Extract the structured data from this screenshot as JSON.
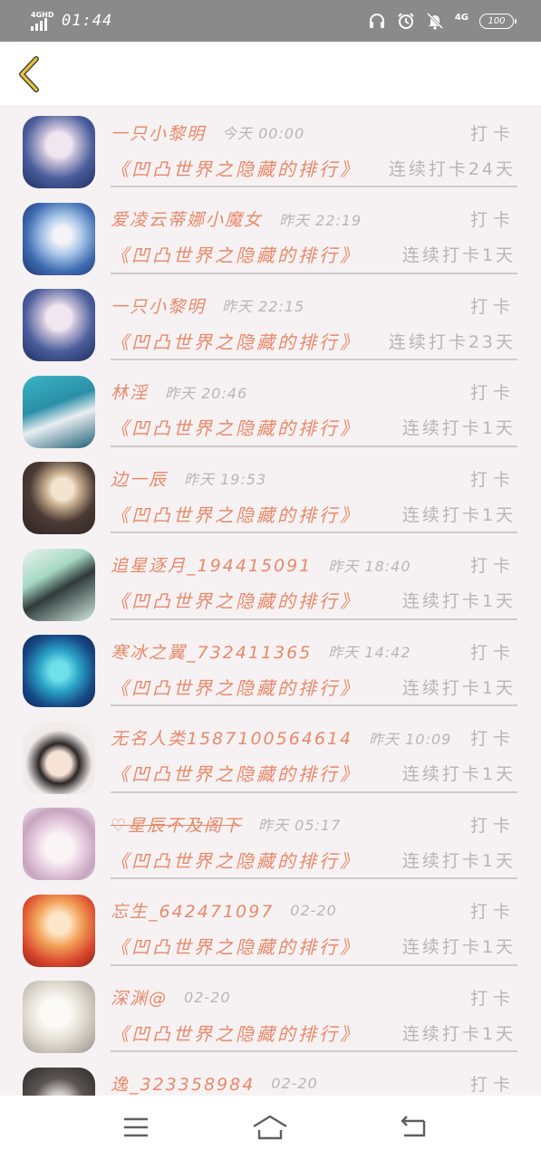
{
  "status_bar": {
    "network": "4GHD",
    "time": "01:44",
    "net_right": "4G",
    "battery": "100"
  },
  "header": {
    "back_icon": "chevron-left-icon",
    "accent_color": "#e8c23a"
  },
  "colors": {
    "name": "#e8896a",
    "muted": "#b9b4b5",
    "background": "#f6f2f3"
  },
  "entries": [
    {
      "name": "一只小黎明",
      "time": "今天 00:00",
      "action": "打卡",
      "board": "《凹凸世界之隐藏的排行》",
      "streak": "连续打卡24天"
    },
    {
      "name": "爱凌云蒂娜小魔女",
      "time": "昨天 22:19",
      "action": "打卡",
      "board": "《凹凸世界之隐藏的排行》",
      "streak": "连续打卡1天"
    },
    {
      "name": "一只小黎明",
      "time": "昨天 22:15",
      "action": "打卡",
      "board": "《凹凸世界之隐藏的排行》",
      "streak": "连续打卡23天"
    },
    {
      "name": "林淫",
      "time": "昨天 20:46",
      "action": "打卡",
      "board": "《凹凸世界之隐藏的排行》",
      "streak": "连续打卡1天"
    },
    {
      "name": "边一辰",
      "time": "昨天 19:53",
      "action": "打卡",
      "board": "《凹凸世界之隐藏的排行》",
      "streak": "连续打卡1天"
    },
    {
      "name": "追星逐月_194415091",
      "time": "昨天 18:40",
      "action": "打卡",
      "board": "《凹凸世界之隐藏的排行》",
      "streak": "连续打卡1天"
    },
    {
      "name": "寒冰之翼_732411365",
      "time": "昨天 14:42",
      "action": "打卡",
      "board": "《凹凸世界之隐藏的排行》",
      "streak": "连续打卡1天"
    },
    {
      "name": "无名人类1587100564614",
      "time": "昨天 10:09",
      "action": "打卡",
      "board": "《凹凸世界之隐藏的排行》",
      "streak": "连续打卡1天"
    },
    {
      "name": "♡星辰不及阁下",
      "time": "昨天 05:17",
      "action": "打卡",
      "board": "《凹凸世界之隐藏的排行》",
      "streak": "连续打卡1天"
    },
    {
      "name": "忘生_642471097",
      "time": "02-20",
      "action": "打卡",
      "board": "《凹凸世界之隐藏的排行》",
      "streak": "连续打卡1天"
    },
    {
      "name": "深渊@",
      "time": "02-20",
      "action": "打卡",
      "board": "《凹凸世界之隐藏的排行》",
      "streak": "连续打卡1天"
    },
    {
      "name": "逸_323358984",
      "time": "02-20",
      "action": "打卡",
      "board": "",
      "streak": ""
    }
  ],
  "bottom_nav": {
    "menu_icon": "menu-icon",
    "home_icon": "home-icon",
    "back_icon": "return-icon"
  }
}
